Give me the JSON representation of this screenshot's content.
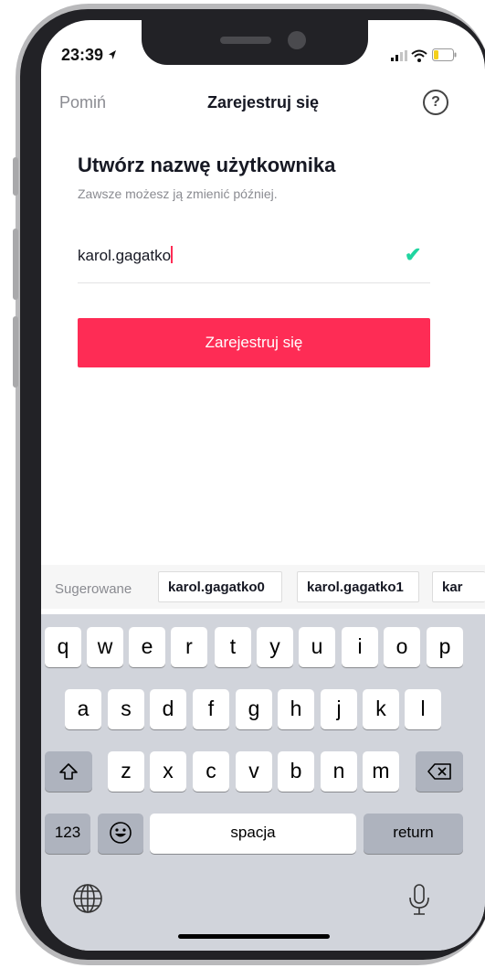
{
  "status_bar": {
    "time": "23:39"
  },
  "nav": {
    "skip_label": "Pomiń",
    "title": "Zarejestruj się",
    "help_symbol": "?"
  },
  "content": {
    "heading": "Utwórz nazwę użytkownika",
    "subheading": "Zawsze możesz ją zmienić później.",
    "username_value": "karol.gagatko",
    "valid_mark": "✔",
    "submit_label": "Zarejestruj się"
  },
  "suggestions": {
    "label": "Sugerowane",
    "items": [
      "karol.gagatko0",
      "karol.gagatko1",
      "kar"
    ]
  },
  "keyboard": {
    "row1": [
      "q",
      "w",
      "e",
      "r",
      "t",
      "y",
      "u",
      "i",
      "o",
      "p"
    ],
    "row2": [
      "a",
      "s",
      "d",
      "f",
      "g",
      "h",
      "j",
      "k",
      "l"
    ],
    "row3": [
      "z",
      "x",
      "c",
      "v",
      "b",
      "n",
      "m"
    ],
    "numbers_label": "123",
    "space_label": "spacja",
    "return_label": "return"
  },
  "colors": {
    "accent": "#fe2c55",
    "check": "#20d5a0"
  }
}
